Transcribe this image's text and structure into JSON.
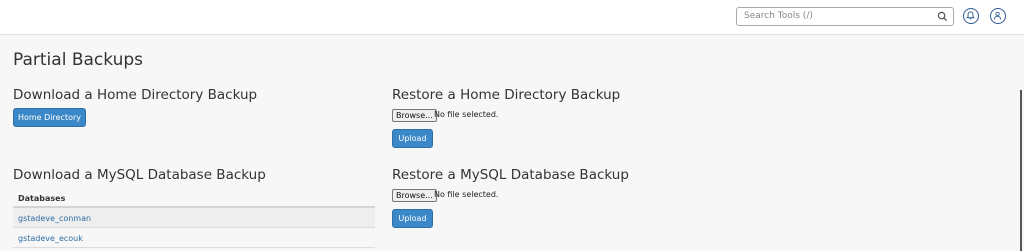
{
  "topbar": {
    "search_placeholder": "Search Tools (/)",
    "icons": [
      "search-icon",
      "bell-icon",
      "user-icon"
    ]
  },
  "page": {
    "title": "Partial Backups"
  },
  "home_download": {
    "title": "Download a Home Directory Backup",
    "button_label": "Home Directory"
  },
  "home_restore": {
    "title": "Restore a Home Directory Backup",
    "browse_label": "Browse...",
    "file_status": "No file selected.",
    "upload_label": "Upload"
  },
  "mysql_download": {
    "title": "Download a MySQL Database Backup",
    "column_header": "Databases",
    "databases": [
      "gstadeve_conman",
      "gstadeve_ecouk"
    ]
  },
  "mysql_restore": {
    "title": "Restore a MySQL Database Backup",
    "browse_label": "Browse...",
    "file_status": "No file selected.",
    "upload_label": "Upload"
  },
  "colors": {
    "accent": "#3b88c8",
    "link": "#2d6da3",
    "icon_ring": "#2d5a97"
  }
}
